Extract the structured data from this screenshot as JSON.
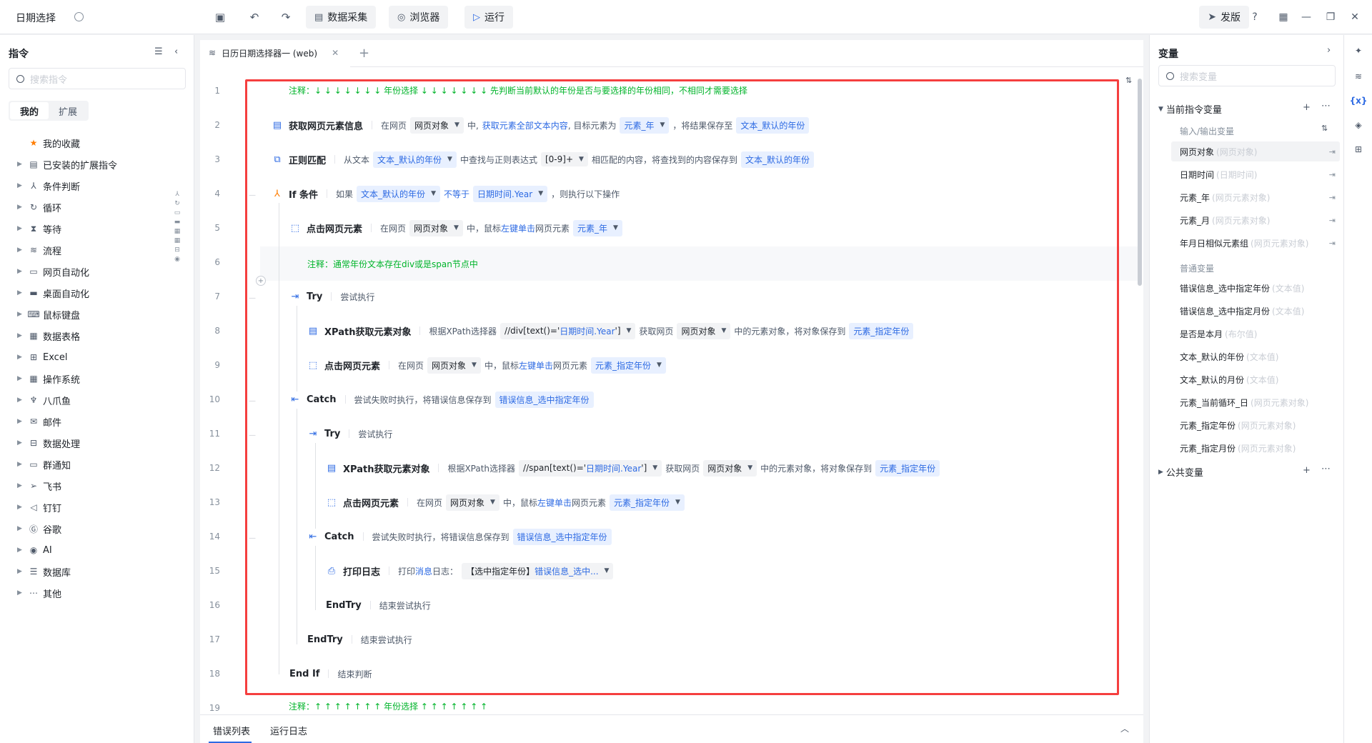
{
  "app": {
    "title": "日期选择"
  },
  "toolbar": {
    "data_collect": "数据采集",
    "browser": "浏览器",
    "run": "运行",
    "publish": "发版"
  },
  "left": {
    "title": "指令",
    "search_placeholder": "搜索指令",
    "tabs": [
      "我的",
      "扩展"
    ],
    "items": [
      "我的收藏",
      "已安装的扩展指令",
      "条件判断",
      "循环",
      "等待",
      "流程",
      "网页自动化",
      "桌面自动化",
      "鼠标键盘",
      "数据表格",
      "Excel",
      "操作系统",
      "八爪鱼",
      "邮件",
      "数据处理",
      "群通知",
      "飞书",
      "钉钉",
      "谷歌",
      "AI",
      "数据库",
      "其他"
    ]
  },
  "editor": {
    "tab_label": "日历日期选择器一 (web)",
    "line_numbers": [
      "1",
      "2",
      "3",
      "4",
      "5",
      "6",
      "7",
      "8",
      "9",
      "10",
      "11",
      "12",
      "13",
      "14",
      "15",
      "16",
      "17",
      "18",
      "19"
    ],
    "l1": "注释：↓ ↓ ↓ ↓ ↓ ↓ ↓  年份选择  ↓ ↓ ↓ ↓ ↓ ↓ ↓  先判断当前默认的年份是否与要选择的年份相同，不相同才需要选择",
    "l2": {
      "name": "获取网页元素信息",
      "a": "在网页",
      "b": "网页对象",
      "c": "中,",
      "d": "获取元素全部文本内容",
      "e": ", 目标元素为",
      "f": "元素_年",
      "g": "，将结果保存至",
      "h": "文本_默认的年份"
    },
    "l3": {
      "name": "正则匹配",
      "a": "从文本",
      "b": "文本_默认的年份",
      "c": "中查找与正则表达式",
      "d": "[0-9]+",
      "e": "相匹配的内容，将查找到的内容保存到",
      "f": "文本_默认的年份"
    },
    "l4": {
      "name": "If 条件",
      "a": "如果",
      "b": "文本_默认的年份",
      "c": "不等于",
      "d": "日期时间.Year",
      "e": "，则执行以下操作"
    },
    "l5": {
      "name": "点击网页元素",
      "a": "在网页",
      "b": "网页对象",
      "c": "中，鼠标",
      "d": "左键单击",
      "e": "网页元素",
      "f": "元素_年"
    },
    "l6": "注释：通常年份文本存在div或是span节点中",
    "l7": {
      "name": "Try",
      "a": "尝试执行"
    },
    "l8": {
      "name": "XPath获取元素对象",
      "a": "根据XPath选择器",
      "b1": "//div[text()='",
      "b2": "日期时间.Year",
      "b3": "']",
      "c": "获取网页",
      "d": "网页对象",
      "e": "中的元素对象，将对象保存到",
      "f": "元素_指定年份"
    },
    "l9": {
      "name": "点击网页元素",
      "a": "在网页",
      "b": "网页对象",
      "c": "中，鼠标",
      "d": "左键单击",
      "e": "网页元素",
      "f": "元素_指定年份"
    },
    "l10": {
      "name": "Catch",
      "a": "尝试失败时执行，将错误信息保存到",
      "b": "错误信息_选中指定年份"
    },
    "l11": {
      "name": "Try",
      "a": "尝试执行"
    },
    "l12": {
      "name": "XPath获取元素对象",
      "a": "根据XPath选择器",
      "b1": "//span[text()='",
      "b2": "日期时间.Year",
      "b3": "']",
      "c": "获取网页",
      "d": "网页对象",
      "e": "中的元素对象，将对象保存到",
      "f": "元素_指定年份"
    },
    "l13": {
      "name": "点击网页元素",
      "a": "在网页",
      "b": "网页对象",
      "c": "中，鼠标",
      "d": "左键单击",
      "e": "网页元素",
      "f": "元素_指定年份"
    },
    "l14": {
      "name": "Catch",
      "a": "尝试失败时执行，将错误信息保存到",
      "b": "错误信息_选中指定年份"
    },
    "l15": {
      "name": "打印日志",
      "a": "打印",
      "b": "消息",
      "c": "日志：",
      "d1": "【选中指定年份】",
      "d2": "错误信息_选中..."
    },
    "l16": {
      "name": "EndTry",
      "a": "结束尝试执行"
    },
    "l17": {
      "name": "EndTry",
      "a": "结束尝试执行"
    },
    "l18": {
      "name": "End If",
      "a": "结束判断"
    },
    "l19": "注释：↑ ↑ ↑ ↑ ↑ ↑ ↑  年份选择  ↑ ↑ ↑ ↑ ↑ ↑ ↑"
  },
  "bottom": {
    "tabs": [
      "错误列表",
      "运行日志"
    ]
  },
  "right": {
    "title": "变量",
    "search_placeholder": "搜索变量",
    "group_current": "当前指令变量",
    "sub_io": "输入/输出变量",
    "io_vars": [
      {
        "name": "网页对象",
        "type": "(网页对象)"
      },
      {
        "name": "日期时间",
        "type": "(日期时间)"
      },
      {
        "name": "元素_年",
        "type": "(网页元素对象)"
      },
      {
        "name": "元素_月",
        "type": "(网页元素对象)"
      },
      {
        "name": "年月日相似元素组",
        "type": "(网页元素对象)"
      }
    ],
    "sub_normal": "普通变量",
    "normal_vars": [
      {
        "name": "错误信息_选中指定年份",
        "type": "(文本值)"
      },
      {
        "name": "错误信息_选中指定月份",
        "type": "(文本值)"
      },
      {
        "name": "是否是本月",
        "type": "(布尔值)"
      },
      {
        "name": "文本_默认的年份",
        "type": "(文本值)"
      },
      {
        "name": "文本_默认的月份",
        "type": "(文本值)"
      },
      {
        "name": "元素_当前循环_日",
        "type": "(网页元素对象)"
      },
      {
        "name": "元素_指定年份",
        "type": "(网页元素对象)"
      },
      {
        "name": "元素_指定月份",
        "type": "(网页元素对象)"
      }
    ],
    "group_public": "公共变量"
  }
}
